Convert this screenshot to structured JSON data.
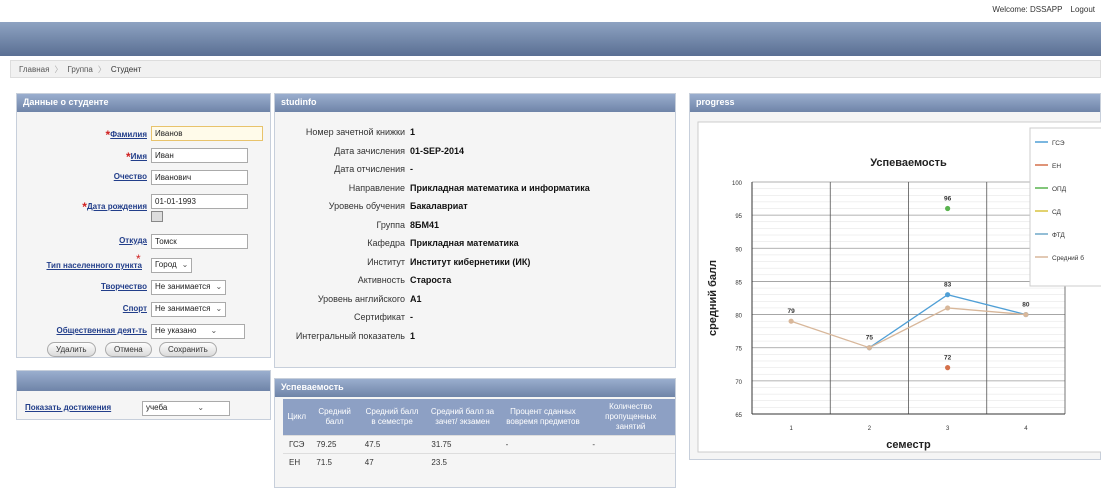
{
  "header": {
    "welcome": "Welcome: DSSAPP",
    "logout": "Logout"
  },
  "breadcrumb": [
    "Главная",
    "Группа",
    "Студент"
  ],
  "student": {
    "title": "Данные о студенте",
    "fields": {
      "surname": {
        "label": "Фамилия",
        "value": "Иванов"
      },
      "name": {
        "label": "Имя",
        "value": "Иван"
      },
      "patronymic": {
        "label": "Очество",
        "value": "Иванович"
      },
      "birthdate": {
        "label": "Дата рождения",
        "value": "01-01-1993"
      },
      "origin": {
        "label": "Откуда",
        "value": "Томск"
      },
      "settlement_type": {
        "label": "Тип населенного пункта",
        "value": "Город"
      },
      "creativity": {
        "label": "Творчество",
        "value": "Не занимается"
      },
      "sport": {
        "label": "Спорт",
        "value": "Не занимается"
      },
      "social": {
        "label": "Общественная деят-ть",
        "value": "Не указано"
      }
    },
    "buttons": {
      "delete": "Удалить",
      "cancel": "Отмена",
      "save": "Сохранить"
    }
  },
  "achievements": {
    "label": "Показать достижения",
    "value": "учеба"
  },
  "studinfo": {
    "title": "studinfo",
    "rows": [
      {
        "k": "Номер зачетной книжки",
        "v": "1"
      },
      {
        "k": "Дата зачисления",
        "v": "01-SEP-2014"
      },
      {
        "k": "Дата отчисления",
        "v": "-"
      },
      {
        "k": "Направление",
        "v": "Прикладная математика и информатика"
      },
      {
        "k": "Уровень обучения",
        "v": "Бакалавриат"
      },
      {
        "k": "Группа",
        "v": "8БМ41"
      },
      {
        "k": "Кафедра",
        "v": "Прикладная математика"
      },
      {
        "k": "Институт",
        "v": "Институт кибернетики (ИК)"
      },
      {
        "k": "Активность",
        "v": "Староста"
      },
      {
        "k": "Уровень английского",
        "v": "A1"
      },
      {
        "k": "Сертификат",
        "v": "-"
      },
      {
        "k": "Интегральный показатель",
        "v": "1"
      }
    ]
  },
  "performance": {
    "title": "Успеваемость",
    "headers": [
      "Цикл",
      "Средний балл",
      "Средний балл в семестре",
      "Средний балл за зачет/ экзамен",
      "Процент сданных вовремя предметов",
      "Количество пропущенных занятий"
    ],
    "rows": [
      [
        "ГСЭ",
        "79.25",
        "47.5",
        "31.75",
        "-",
        "-"
      ],
      [
        "ЕН",
        "71.5",
        "47",
        "23.5",
        "",
        ""
      ]
    ]
  },
  "progress_panel": {
    "title": "progress"
  },
  "colors": {
    "gse": "#4f9fd6",
    "en": "#d4704a",
    "opd": "#59b34e",
    "sd": "#d9c23f",
    "ftd": "#6fa9c9",
    "avg": "#d8b79a"
  },
  "chart_data": {
    "type": "line",
    "title": "Успеваемость",
    "xlabel": "семестр",
    "ylabel": "средний балл",
    "x": [
      1,
      2,
      3,
      4
    ],
    "ylim": [
      65,
      100
    ],
    "yticks": [
      65,
      70,
      75,
      80,
      85,
      90,
      95,
      100
    ],
    "legend": "right",
    "series": [
      {
        "name": "ГСЭ",
        "color": "#4f9fd6",
        "values": [
          null,
          75,
          83,
          80
        ]
      },
      {
        "name": "ЕН",
        "color": "#d4704a",
        "values": [
          null,
          null,
          72,
          null
        ]
      },
      {
        "name": "ОПД",
        "color": "#59b34e",
        "values": [
          null,
          null,
          96,
          null
        ]
      },
      {
        "name": "СД",
        "color": "#d9c23f",
        "values": [
          null,
          null,
          null,
          null
        ]
      },
      {
        "name": "ФТД",
        "color": "#6fa9c9",
        "values": [
          null,
          null,
          null,
          null
        ]
      },
      {
        "name": "Средний б",
        "color": "#d8b79a",
        "values": [
          79,
          75,
          81,
          80
        ]
      }
    ],
    "point_labels": [
      {
        "x": 1,
        "y": 79,
        "text": "79"
      },
      {
        "x": 2,
        "y": 75,
        "text": "75"
      },
      {
        "x": 3,
        "y": 83,
        "text": "83"
      },
      {
        "x": 3,
        "y": 96,
        "text": "96"
      },
      {
        "x": 3,
        "y": 72,
        "text": "72"
      },
      {
        "x": 4,
        "y": 80,
        "text": "80"
      }
    ]
  }
}
